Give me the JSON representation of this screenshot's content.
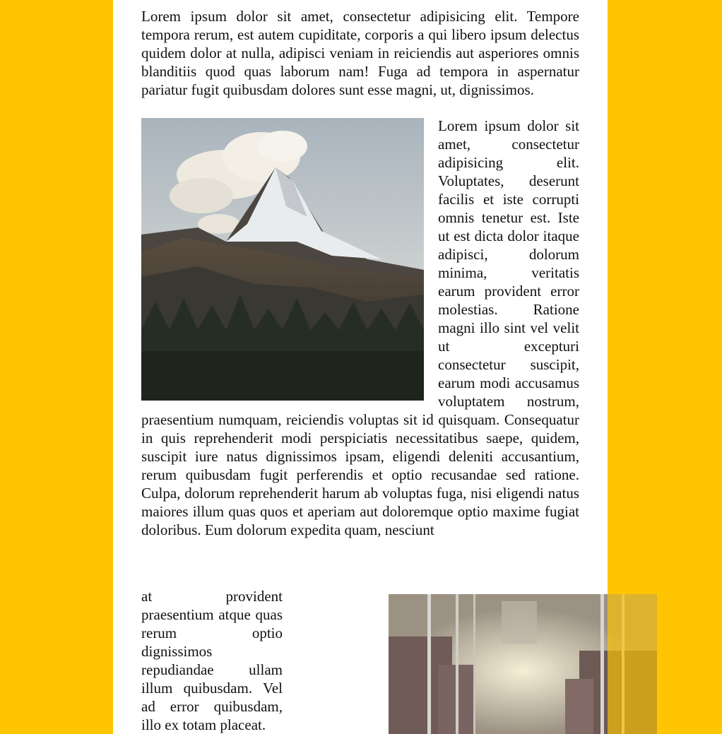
{
  "article": {
    "paragraph_1": "Lorem ipsum dolor sit amet, consectetur adipisicing elit. Tempore tempora rerum, est autem cupiditate, corporis a qui libero ipsum delectus quidem dolor at nulla, adipisci veniam in reiciendis aut asperiores omnis blanditiis quod quas laborum nam! Fuga ad tempora in aspernatur pariatur fugit quibusdam dolores sunt esse magni, ut, dignissimos.",
    "paragraph_2": "Lorem ipsum dolor sit amet, consectetur adipisicing elit. Voluptates, deserunt facilis et iste corrupti omnis tenetur est. Iste ut est dicta dolor itaque adipisci, dolorum minima, veritatis earum provident error molestias. Ratione magni illo sint vel velit ut excepturi consectetur suscipit, earum modi accusamus voluptatem nostrum, praesentium numquam, reiciendis voluptas sit id quisquam. Consequatur in quis reprehenderit modi perspiciatis necessitatibus saepe, quidem, suscipit iure natus dignissimos ipsam, eligendi deleniti accusantium, rerum quibusdam fugit perferendis et optio recusandae sed ratione. Culpa, dolorum reprehenderit harum ab voluptas fuga, nisi eligendi natus maiores illum quas quos et aperiam aut doloremque optio maxime fugiat doloribus. Eum dolorum expedita quam, nesciunt",
    "paragraph_3": "at provident praesentium atque quas rerum optio dignissimos repudiandae ullam illum quibusdam. Vel ad error quibusdam, illo ex totam placeat."
  },
  "colors": {
    "background": "#ffc500",
    "page": "#ffffff"
  }
}
